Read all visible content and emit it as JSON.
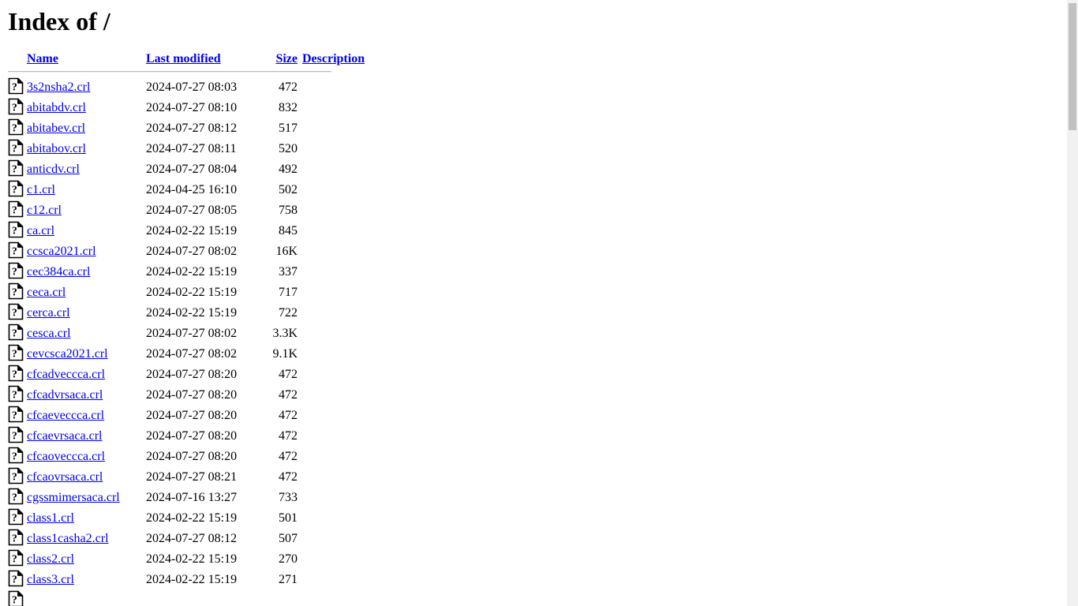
{
  "page": {
    "title": "Index of /",
    "background_color": "#ffffff",
    "link_color": "#0000ee",
    "text_color": "#000000"
  },
  "table": {
    "columns": [
      {
        "key": "icon",
        "label": ""
      },
      {
        "key": "name",
        "label": "Name"
      },
      {
        "key": "date",
        "label": "Last modified"
      },
      {
        "key": "size",
        "label": "Size"
      },
      {
        "key": "desc",
        "label": "Description"
      }
    ],
    "icon_name": "unknown-file-icon",
    "rows": [
      {
        "icon": "unknown-file-icon",
        "name": "3s2nsha2.crl",
        "date": "2024-07-27 08:03",
        "size": "472",
        "desc": ""
      },
      {
        "icon": "unknown-file-icon",
        "name": "abitabdv.crl",
        "date": "2024-07-27 08:10",
        "size": "832",
        "desc": ""
      },
      {
        "icon": "unknown-file-icon",
        "name": "abitabev.crl",
        "date": "2024-07-27 08:12",
        "size": "517",
        "desc": ""
      },
      {
        "icon": "unknown-file-icon",
        "name": "abitabov.crl",
        "date": "2024-07-27 08:11",
        "size": "520",
        "desc": ""
      },
      {
        "icon": "unknown-file-icon",
        "name": "anticdv.crl",
        "date": "2024-07-27 08:04",
        "size": "492",
        "desc": ""
      },
      {
        "icon": "unknown-file-icon",
        "name": "c1.crl",
        "date": "2024-04-25 16:10",
        "size": "502",
        "desc": ""
      },
      {
        "icon": "unknown-file-icon",
        "name": "c12.crl",
        "date": "2024-07-27 08:05",
        "size": "758",
        "desc": ""
      },
      {
        "icon": "unknown-file-icon",
        "name": "ca.crl",
        "date": "2024-02-22 15:19",
        "size": "845",
        "desc": ""
      },
      {
        "icon": "unknown-file-icon",
        "name": "ccsca2021.crl",
        "date": "2024-07-27 08:02",
        "size": "16K",
        "desc": ""
      },
      {
        "icon": "unknown-file-icon",
        "name": "cec384ca.crl",
        "date": "2024-02-22 15:19",
        "size": "337",
        "desc": ""
      },
      {
        "icon": "unknown-file-icon",
        "name": "ceca.crl",
        "date": "2024-02-22 15:19",
        "size": "717",
        "desc": ""
      },
      {
        "icon": "unknown-file-icon",
        "name": "cerca.crl",
        "date": "2024-02-22 15:19",
        "size": "722",
        "desc": ""
      },
      {
        "icon": "unknown-file-icon",
        "name": "cesca.crl",
        "date": "2024-07-27 08:02",
        "size": "3.3K",
        "desc": ""
      },
      {
        "icon": "unknown-file-icon",
        "name": "cevcsca2021.crl",
        "date": "2024-07-27 08:02",
        "size": "9.1K",
        "desc": ""
      },
      {
        "icon": "unknown-file-icon",
        "name": "cfcadveccca.crl",
        "date": "2024-07-27 08:20",
        "size": "472",
        "desc": ""
      },
      {
        "icon": "unknown-file-icon",
        "name": "cfcadvrsaca.crl",
        "date": "2024-07-27 08:20",
        "size": "472",
        "desc": ""
      },
      {
        "icon": "unknown-file-icon",
        "name": "cfcaeveccca.crl",
        "date": "2024-07-27 08:20",
        "size": "472",
        "desc": ""
      },
      {
        "icon": "unknown-file-icon",
        "name": "cfcaevrsaca.crl",
        "date": "2024-07-27 08:20",
        "size": "472",
        "desc": ""
      },
      {
        "icon": "unknown-file-icon",
        "name": "cfcaoveccca.crl",
        "date": "2024-07-27 08:20",
        "size": "472",
        "desc": ""
      },
      {
        "icon": "unknown-file-icon",
        "name": "cfcaovrsaca.crl",
        "date": "2024-07-27 08:21",
        "size": "472",
        "desc": ""
      },
      {
        "icon": "unknown-file-icon",
        "name": "cgssmimersaca.crl",
        "date": "2024-07-16 13:27",
        "size": "733",
        "desc": ""
      },
      {
        "icon": "unknown-file-icon",
        "name": "class1.crl",
        "date": "2024-02-22 15:19",
        "size": "501",
        "desc": ""
      },
      {
        "icon": "unknown-file-icon",
        "name": "class1casha2.crl",
        "date": "2024-07-27 08:12",
        "size": "507",
        "desc": ""
      },
      {
        "icon": "unknown-file-icon",
        "name": "class2.crl",
        "date": "2024-02-22 15:19",
        "size": "270",
        "desc": ""
      },
      {
        "icon": "unknown-file-icon",
        "name": "class3.crl",
        "date": "2024-02-22 15:19",
        "size": "271",
        "desc": ""
      },
      {
        "icon": "unknown-file-icon",
        "name": "",
        "date": "",
        "size": "",
        "desc": ""
      }
    ]
  },
  "scrollbar": {
    "track_color": "#f1f1f1",
    "thumb_color": "#c1c1c1",
    "orientation": "vertical"
  }
}
